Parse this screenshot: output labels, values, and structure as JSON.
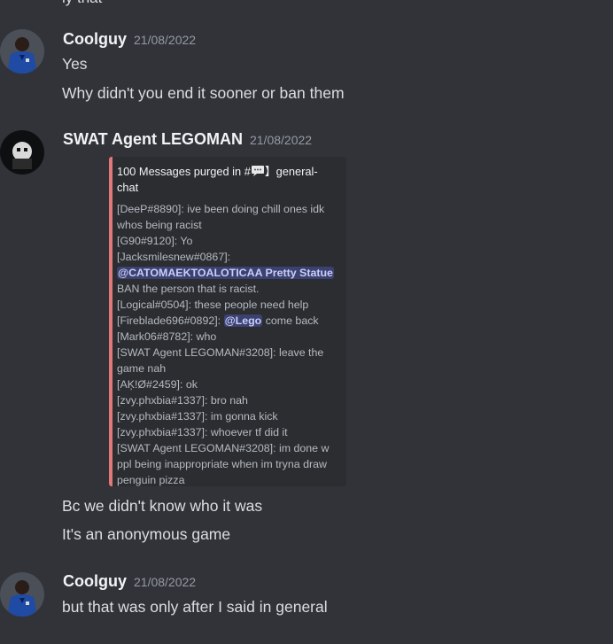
{
  "top_fragment": "ly that",
  "messages": [
    {
      "username": "Coolguy",
      "timestamp": "21/08/2022",
      "lines": [
        "Yes",
        "Why didn't you end it sooner or ban them"
      ]
    },
    {
      "username": "SWAT Agent LEGOMAN",
      "timestamp": "21/08/2022",
      "embed": {
        "title_prefix": "100 Messages purged in #",
        "title_suffix": "】general-chat",
        "lines": [
          "[DeeP#8890]: ive been doing chill ones idk whos being racist",
          "[G90#9120]: Yo",
          "[Jacksmilesnew#0867]:",
          "[Logical#0504]: these people need help",
          "[Fireblade696#0892]: ",
          "[Mark06#8782]: who",
          "[SWAT Agent LEGOMAN#3208]: leave the game nah",
          "[AĶ!Ø#2459]: ok",
          "[zvy.phxbia#1337]: bro nah",
          "[zvy.phxbia#1337]: im gonna kick",
          "[zvy.phxbia#1337]: whoever tf did it",
          "[SWAT Agent LEGOMAN#3208]: im done w ppl being inappropriate when im tryna draw penguin pizza"
        ],
        "mention_catomaek": "@CATOMAEKTOALOTICAA Pretty Statue",
        "after_catomaek": " BAN the person that is racist.",
        "mention_lego": "@Lego",
        "after_lego": " come back"
      },
      "lines": [
        "Bc we didn't know who it was",
        "It's an anonymous game"
      ]
    },
    {
      "username": "Coolguy",
      "timestamp": "21/08/2022",
      "lines": [
        "but that was only after I said in general"
      ]
    }
  ],
  "colors": {
    "background": "#313338",
    "embed_bg": "#2b2d31",
    "embed_border": "#e2787b",
    "mention_bg": "#3c4270"
  },
  "icons": [
    "avatar-coolguy",
    "avatar-legoman",
    "speech-bubble-icon"
  ]
}
